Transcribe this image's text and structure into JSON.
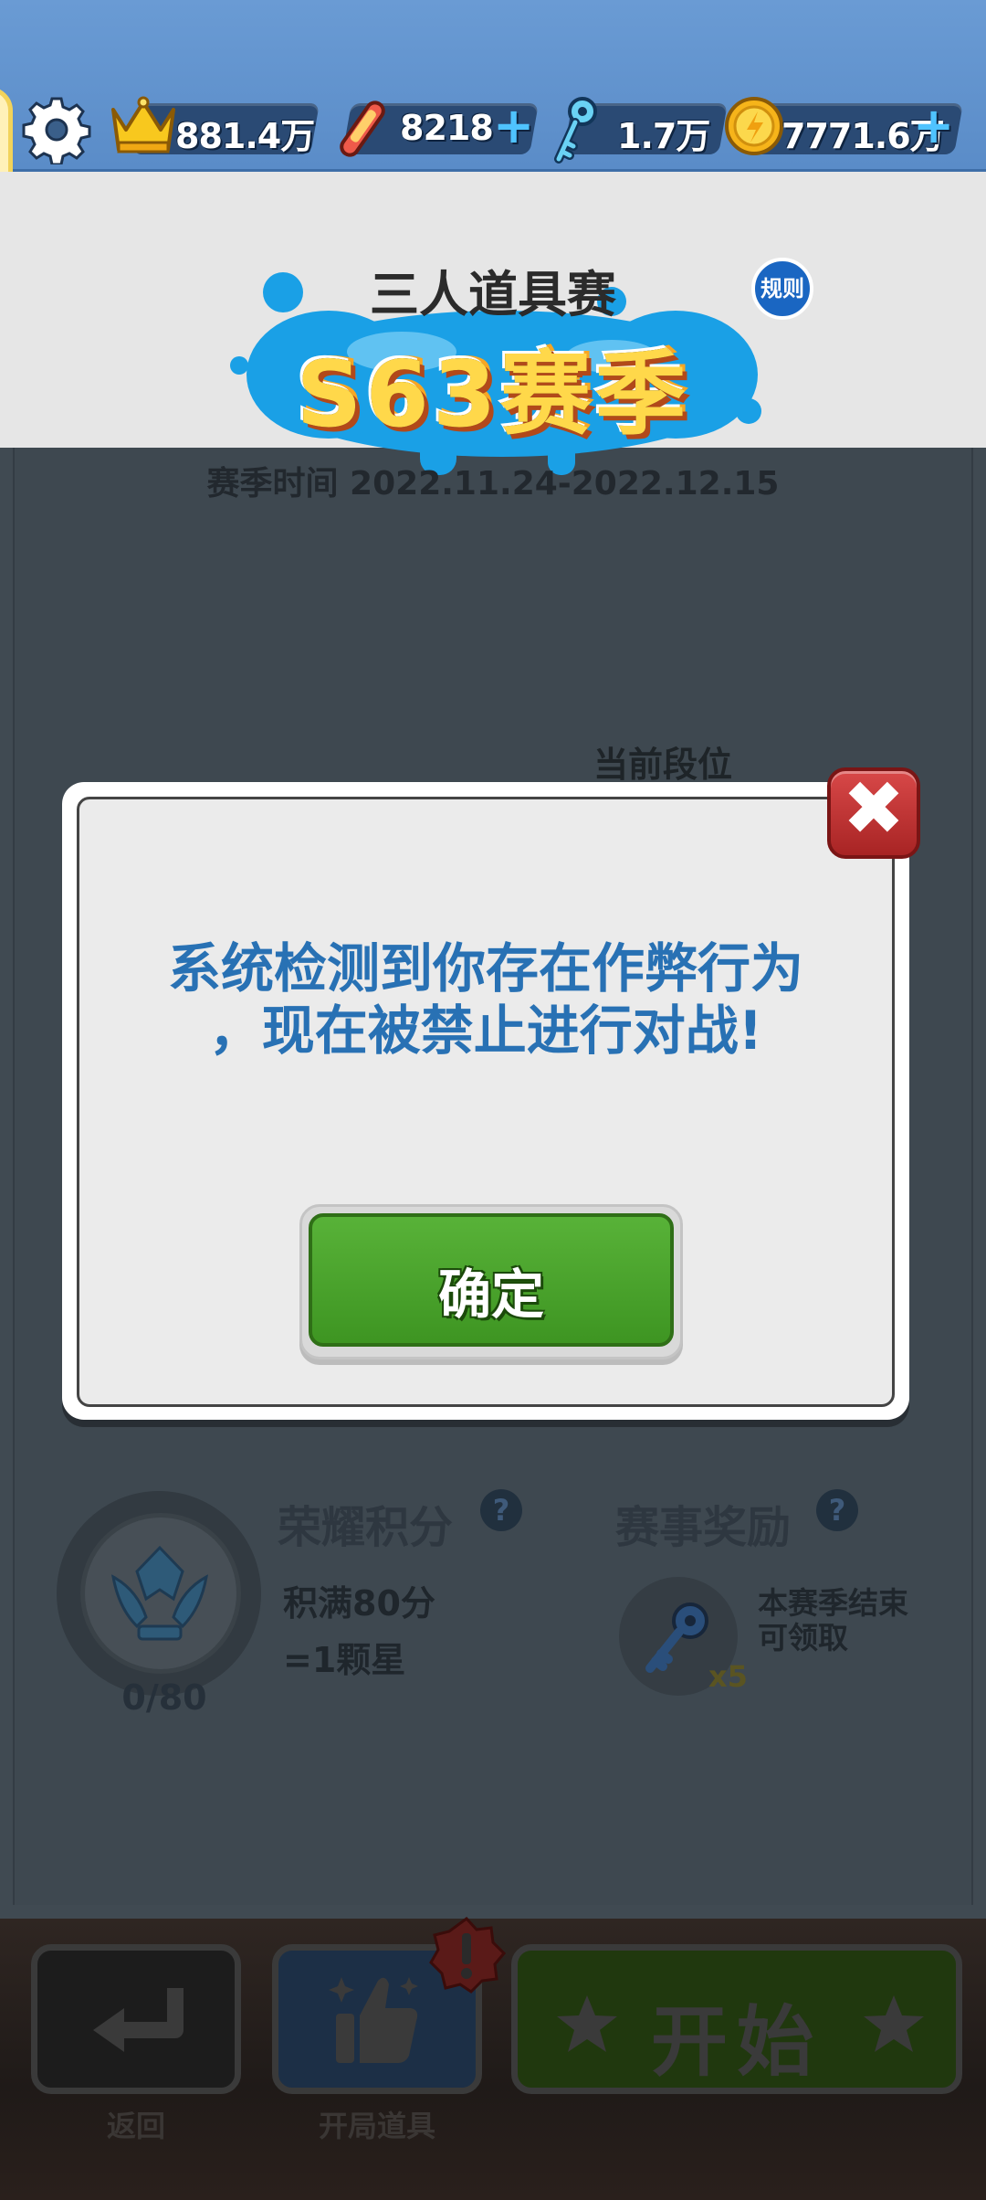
{
  "resources": {
    "crowns": "881.4万",
    "boards": "8218",
    "keys": "1.7万",
    "coins": "7771.6万"
  },
  "season": {
    "mode_title": "三人道具赛",
    "season_label": "S63赛季",
    "rules_button": "规则",
    "season_time": "赛季时间 2022.11.24-2022.12.15",
    "current_rank_label": "当前段位"
  },
  "honor": {
    "title": "荣耀积分",
    "help": "?",
    "desc_line1": "积满80分",
    "desc_line2": "=1颗星",
    "progress": "0/80"
  },
  "reward": {
    "title": "赛事奖励",
    "help": "?",
    "count": "x5",
    "desc_line1": "本赛季结束",
    "desc_line2": "可领取"
  },
  "bottom": {
    "back_label": "返回",
    "items_label": "开局道具",
    "start_label": "开始"
  },
  "modal": {
    "message_line1": "系统检测到你存在作弊行为",
    "message_line2": "，现在被禁止进行对战!",
    "confirm_label": "确定",
    "close_symbol": "✖"
  },
  "colors": {
    "topbar": "#6a9bd4",
    "modal_text": "#2871b4",
    "confirm_green": "#4ca42c",
    "close_red": "#c13434"
  }
}
